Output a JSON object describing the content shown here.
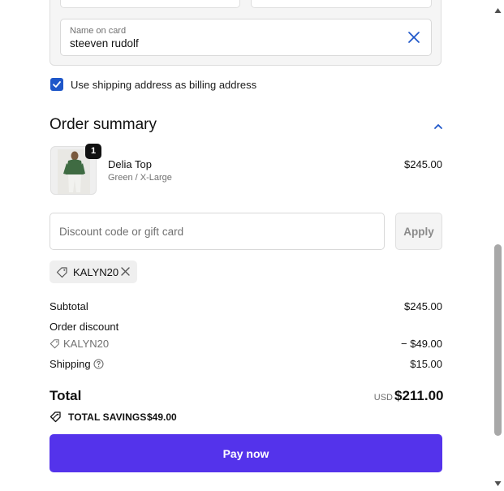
{
  "card_form": {
    "name_label": "Name on card",
    "name_value": "steeven rudolf"
  },
  "billing": {
    "checkbox_label": "Use shipping address as billing address",
    "checked": true
  },
  "summary": {
    "title": "Order summary",
    "item": {
      "quantity": "1",
      "name": "Delia Top",
      "variant": "Green / X-Large",
      "price": "$245.00"
    },
    "discount_placeholder": "Discount code or gift card",
    "apply_label": "Apply",
    "applied_code": "KALYN20",
    "subtotal_label": "Subtotal",
    "subtotal_value": "$245.00",
    "order_discount_label": "Order discount",
    "order_discount_code": "KALYN20",
    "order_discount_value": "− $49.00",
    "shipping_label": "Shipping",
    "shipping_value": "$15.00",
    "total_label": "Total",
    "currency": "USD",
    "total_value": "$211.00",
    "savings_label": "TOTAL SAVINGS",
    "savings_value": "$49.00"
  },
  "pay_label": "Pay now",
  "colors": {
    "accent": "#5433eb",
    "checkbox": "#1f57c9",
    "clear_icon": "#1f57c9"
  }
}
